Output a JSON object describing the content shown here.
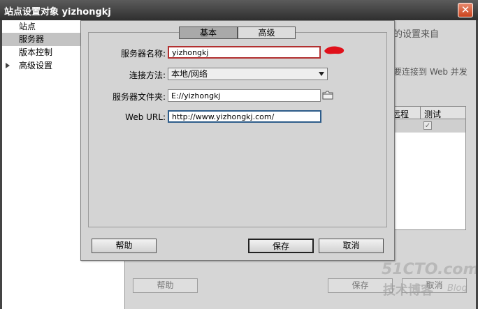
{
  "window": {
    "title": "站点设置对象 yizhongkj"
  },
  "sidebar": {
    "items": [
      {
        "label": "站点"
      },
      {
        "label": "服务器"
      },
      {
        "label": "版本控制"
      },
      {
        "label": "高级设置"
      }
    ]
  },
  "background": {
    "text_line1": "的设置来自",
    "text_line2": "要连接到 Web 并发",
    "table_headers": [
      "远程",
      "测试"
    ],
    "help_label": "帮助",
    "save_label": "保存",
    "cancel_label": "取消"
  },
  "dialog": {
    "tabs": [
      {
        "label": "基本"
      },
      {
        "label": "高级"
      }
    ],
    "server_name_label": "服务器名称:",
    "server_name_value": "yizhongkj",
    "connect_method_label": "连接方法:",
    "connect_method_value": "本地/网络",
    "server_folder_label": "服务器文件夹:",
    "server_folder_value": "E://yizhongkj",
    "web_url_label": "Web URL:",
    "web_url_value": "http://www.yizhongkj.com/",
    "help_label": "帮助",
    "save_label": "保存",
    "cancel_label": "取消"
  },
  "watermark": {
    "line1": "51CTO.com",
    "line2": "技术博客",
    "line3": "Blog"
  },
  "colors": {
    "title_bar": "#3a3a3a",
    "selected_item": "#c3c3c3",
    "error_border": "#b23030",
    "focus_border": "#2d5c8a",
    "annotation": "#e0101a"
  },
  "icons": [
    "close-icon",
    "expand-triangle-icon",
    "dropdown-arrow-icon",
    "folder-icon",
    "checkbox-icon"
  ]
}
